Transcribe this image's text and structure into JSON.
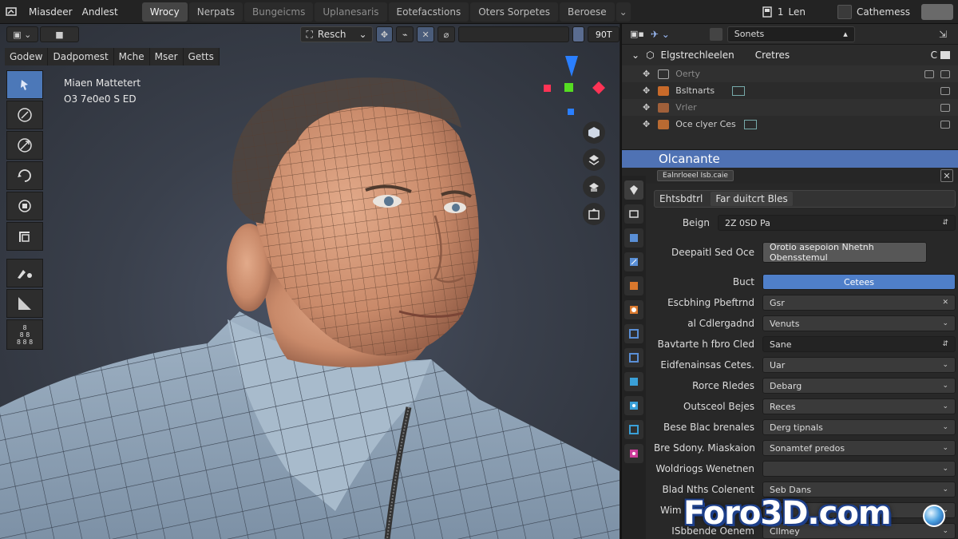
{
  "topbar": {
    "app_menus": [
      "Miasdeer",
      "Andlest"
    ],
    "tabs": [
      {
        "label": "Wrocy",
        "state": "active"
      },
      {
        "label": "Nerpats",
        "state": "normal"
      },
      {
        "label": "Bungeicms",
        "state": "dim"
      },
      {
        "label": "Uplanesaris",
        "state": "dim"
      },
      {
        "label": "Eotefacstions",
        "state": "normal"
      },
      {
        "label": "Oters Sorpetes",
        "state": "normal"
      },
      {
        "label": "Beroese",
        "state": "normal"
      }
    ],
    "scene_label": "1",
    "scene_name": "Len",
    "view_layer": "Cathemess"
  },
  "viewport": {
    "mode_label": "Resch",
    "value_field": "90T",
    "menu": [
      "Godew",
      "Dadpomest",
      "Mche",
      "Mser",
      "Getts"
    ],
    "info_line1": "Miaen Mattetert",
    "info_line2": "O3 7e0e0 S ED",
    "tool_small_text": [
      "8",
      "8 8",
      "8 8 8"
    ]
  },
  "gizmo_colors": {
    "z": "#2a7fff",
    "x": "#ff3355",
    "y": "#55dd22"
  },
  "outliner": {
    "search_label": "Sonets",
    "header_name": "Elgstrechleelen",
    "header_right": "Cretres",
    "header_c": "C",
    "rows": [
      {
        "name": "Oerty",
        "dim": true
      },
      {
        "name": "Bsltnarts",
        "dim": false
      },
      {
        "name": "Vrler",
        "dim": true
      },
      {
        "name": "Oce clyer Ces",
        "dim": false
      }
    ]
  },
  "properties": {
    "selected_object": "Olcanante",
    "sub_pill": "Ealnrloeel Isb.caie",
    "section_title": "Ehtsbdtrl",
    "section_sub": "Far duitcrt Bles",
    "begin_label": "Beign",
    "begin_value": "2Z 0SD Pa",
    "deep_label": "Deepaitl Sed Oce",
    "deep_button": "Orotio asepoion Nhetnh Obensstemul",
    "rows": [
      {
        "label": "Buct",
        "value": "Cetees",
        "style": "blue"
      },
      {
        "label": "Escbhing Pbeftrnd",
        "value": "Gsr",
        "style": "close"
      },
      {
        "label": "al Cdlergadnd",
        "value": "Venuts",
        "style": "dropdown"
      },
      {
        "label": "Bavtarte h fbro Cled",
        "value": "Sane",
        "style": "dark"
      },
      {
        "label": "Eidfenainsas Cetes.",
        "value": "Uar",
        "style": "dropdown"
      },
      {
        "label": "Rorce Rledes",
        "value": "Debarg",
        "style": "dropdown"
      },
      {
        "label": "Outsceol Bejes",
        "value": "Reces",
        "style": "dropdown"
      },
      {
        "label": "Bese Blac brenales",
        "value": "Derg tipnals",
        "style": "dropdown"
      },
      {
        "label": "Bre Sdony. Miaskaion",
        "value": "Sonamtef predos",
        "style": "dropdown"
      },
      {
        "label": "Woldriogs Wenetnen",
        "value": "",
        "style": "dropdown"
      },
      {
        "label": "Blad  Nths Colenent",
        "value": "Seb Dans",
        "style": "dropdown"
      },
      {
        "label": "Wim",
        "value": "",
        "style": "dropdown"
      },
      {
        "label": "ISbbende  Oenem",
        "value": "Cllmey",
        "style": "dropdown"
      }
    ]
  },
  "watermark": "Foro3D.com"
}
